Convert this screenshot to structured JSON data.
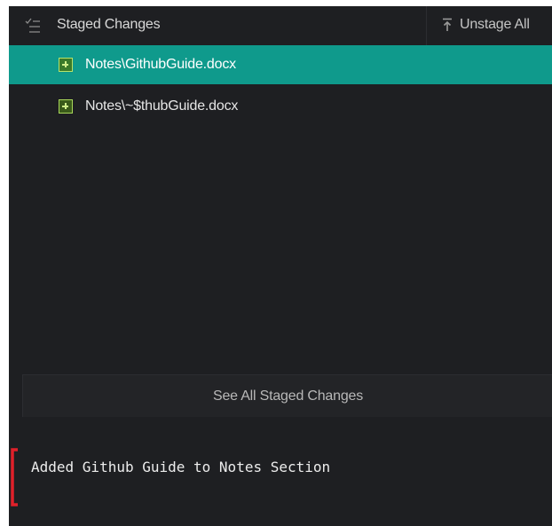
{
  "staged_section": {
    "title": "Staged Changes",
    "header_icon": "checklist-icon",
    "unstage_all_label": "Unstage All",
    "unstage_icon": "arrow-up-to-line-icon"
  },
  "files": [
    {
      "name": "Notes\\GithubGuide.docx",
      "status_icon": "added-file-icon",
      "selected": true
    },
    {
      "name": "Notes\\~$thubGuide.docx",
      "status_icon": "added-file-icon",
      "selected": false
    }
  ],
  "see_all_label": "See All Staged Changes",
  "commit_message": "Added Github Guide to Notes Section",
  "colors": {
    "panel_bg": "#1e1f22",
    "selection": "#0f9a8c",
    "added_icon": "#a8d65a",
    "highlight_bracket": "#e0202a"
  }
}
